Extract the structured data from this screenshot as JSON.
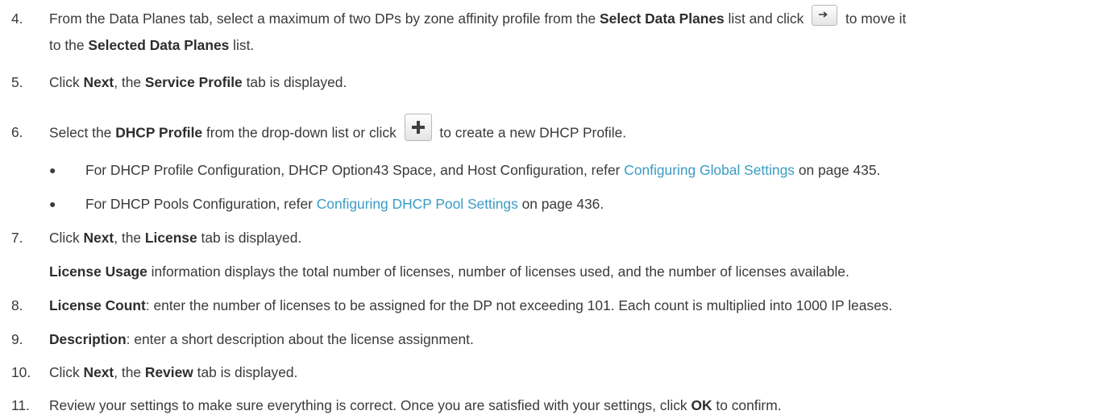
{
  "steps": {
    "s4": {
      "num": "4.",
      "t1": "From the Data Planes tab, select a maximum of two DPs by zone affinity profile from the ",
      "b1": "Select Data Planes",
      "t2": " list and click ",
      "t3": " to move it",
      "t4": "to the ",
      "b2": "Selected Data Planes",
      "t5": " list."
    },
    "s5": {
      "num": "5.",
      "t1": "Click ",
      "b1": "Next",
      "t2": ", the ",
      "b2": "Service Profile",
      "t3": " tab is displayed."
    },
    "s6": {
      "num": "6.",
      "t1": "Select the ",
      "b1": "DHCP Profile",
      "t2": " from the drop-down list or click ",
      "t3": " to create a new DHCP Profile.",
      "bullets": [
        {
          "pre": "For DHCP Profile Configuration, DHCP Option43 Space, and Host Configuration, refer ",
          "link": "Configuring Global Settings",
          "post": " on page 435."
        },
        {
          "pre": "For DHCP Pools Configuration, refer ",
          "link": "Configuring DHCP Pool Settings",
          "post": " on page 436."
        }
      ]
    },
    "s7": {
      "num": "7.",
      "t1": "Click ",
      "b1": "Next",
      "t2": ", the ",
      "b2": "License",
      "t3": " tab is displayed.",
      "p_b": "License Usage",
      "p_t": " information displays the total number of licenses, number of licenses used, and the number of licenses available."
    },
    "s8": {
      "num": "8.",
      "b1": "License Count",
      "t1": ": enter the number of licenses to be assigned for the DP not exceeding 101. Each count is multiplied into 1000 IP leases."
    },
    "s9": {
      "num": "9.",
      "b1": "Description",
      "t1": ": enter a short description about the license assignment."
    },
    "s10": {
      "num": "10.",
      "t1": "Click ",
      "b1": "Next",
      "t2": ", the ",
      "b2": "Review",
      "t3": " tab is displayed."
    },
    "s11": {
      "num": "11.",
      "t1": "Review your settings to make sure everything is correct. Once you are satisfied with your settings, click ",
      "b1": "OK",
      "t2": " to confirm."
    }
  },
  "icons": {
    "move": "arrow-right-icon",
    "add": "plus-icon"
  },
  "colors": {
    "text": "#3a3a3a",
    "link": "#3a9cc4",
    "plus": "#3f3f3f"
  }
}
